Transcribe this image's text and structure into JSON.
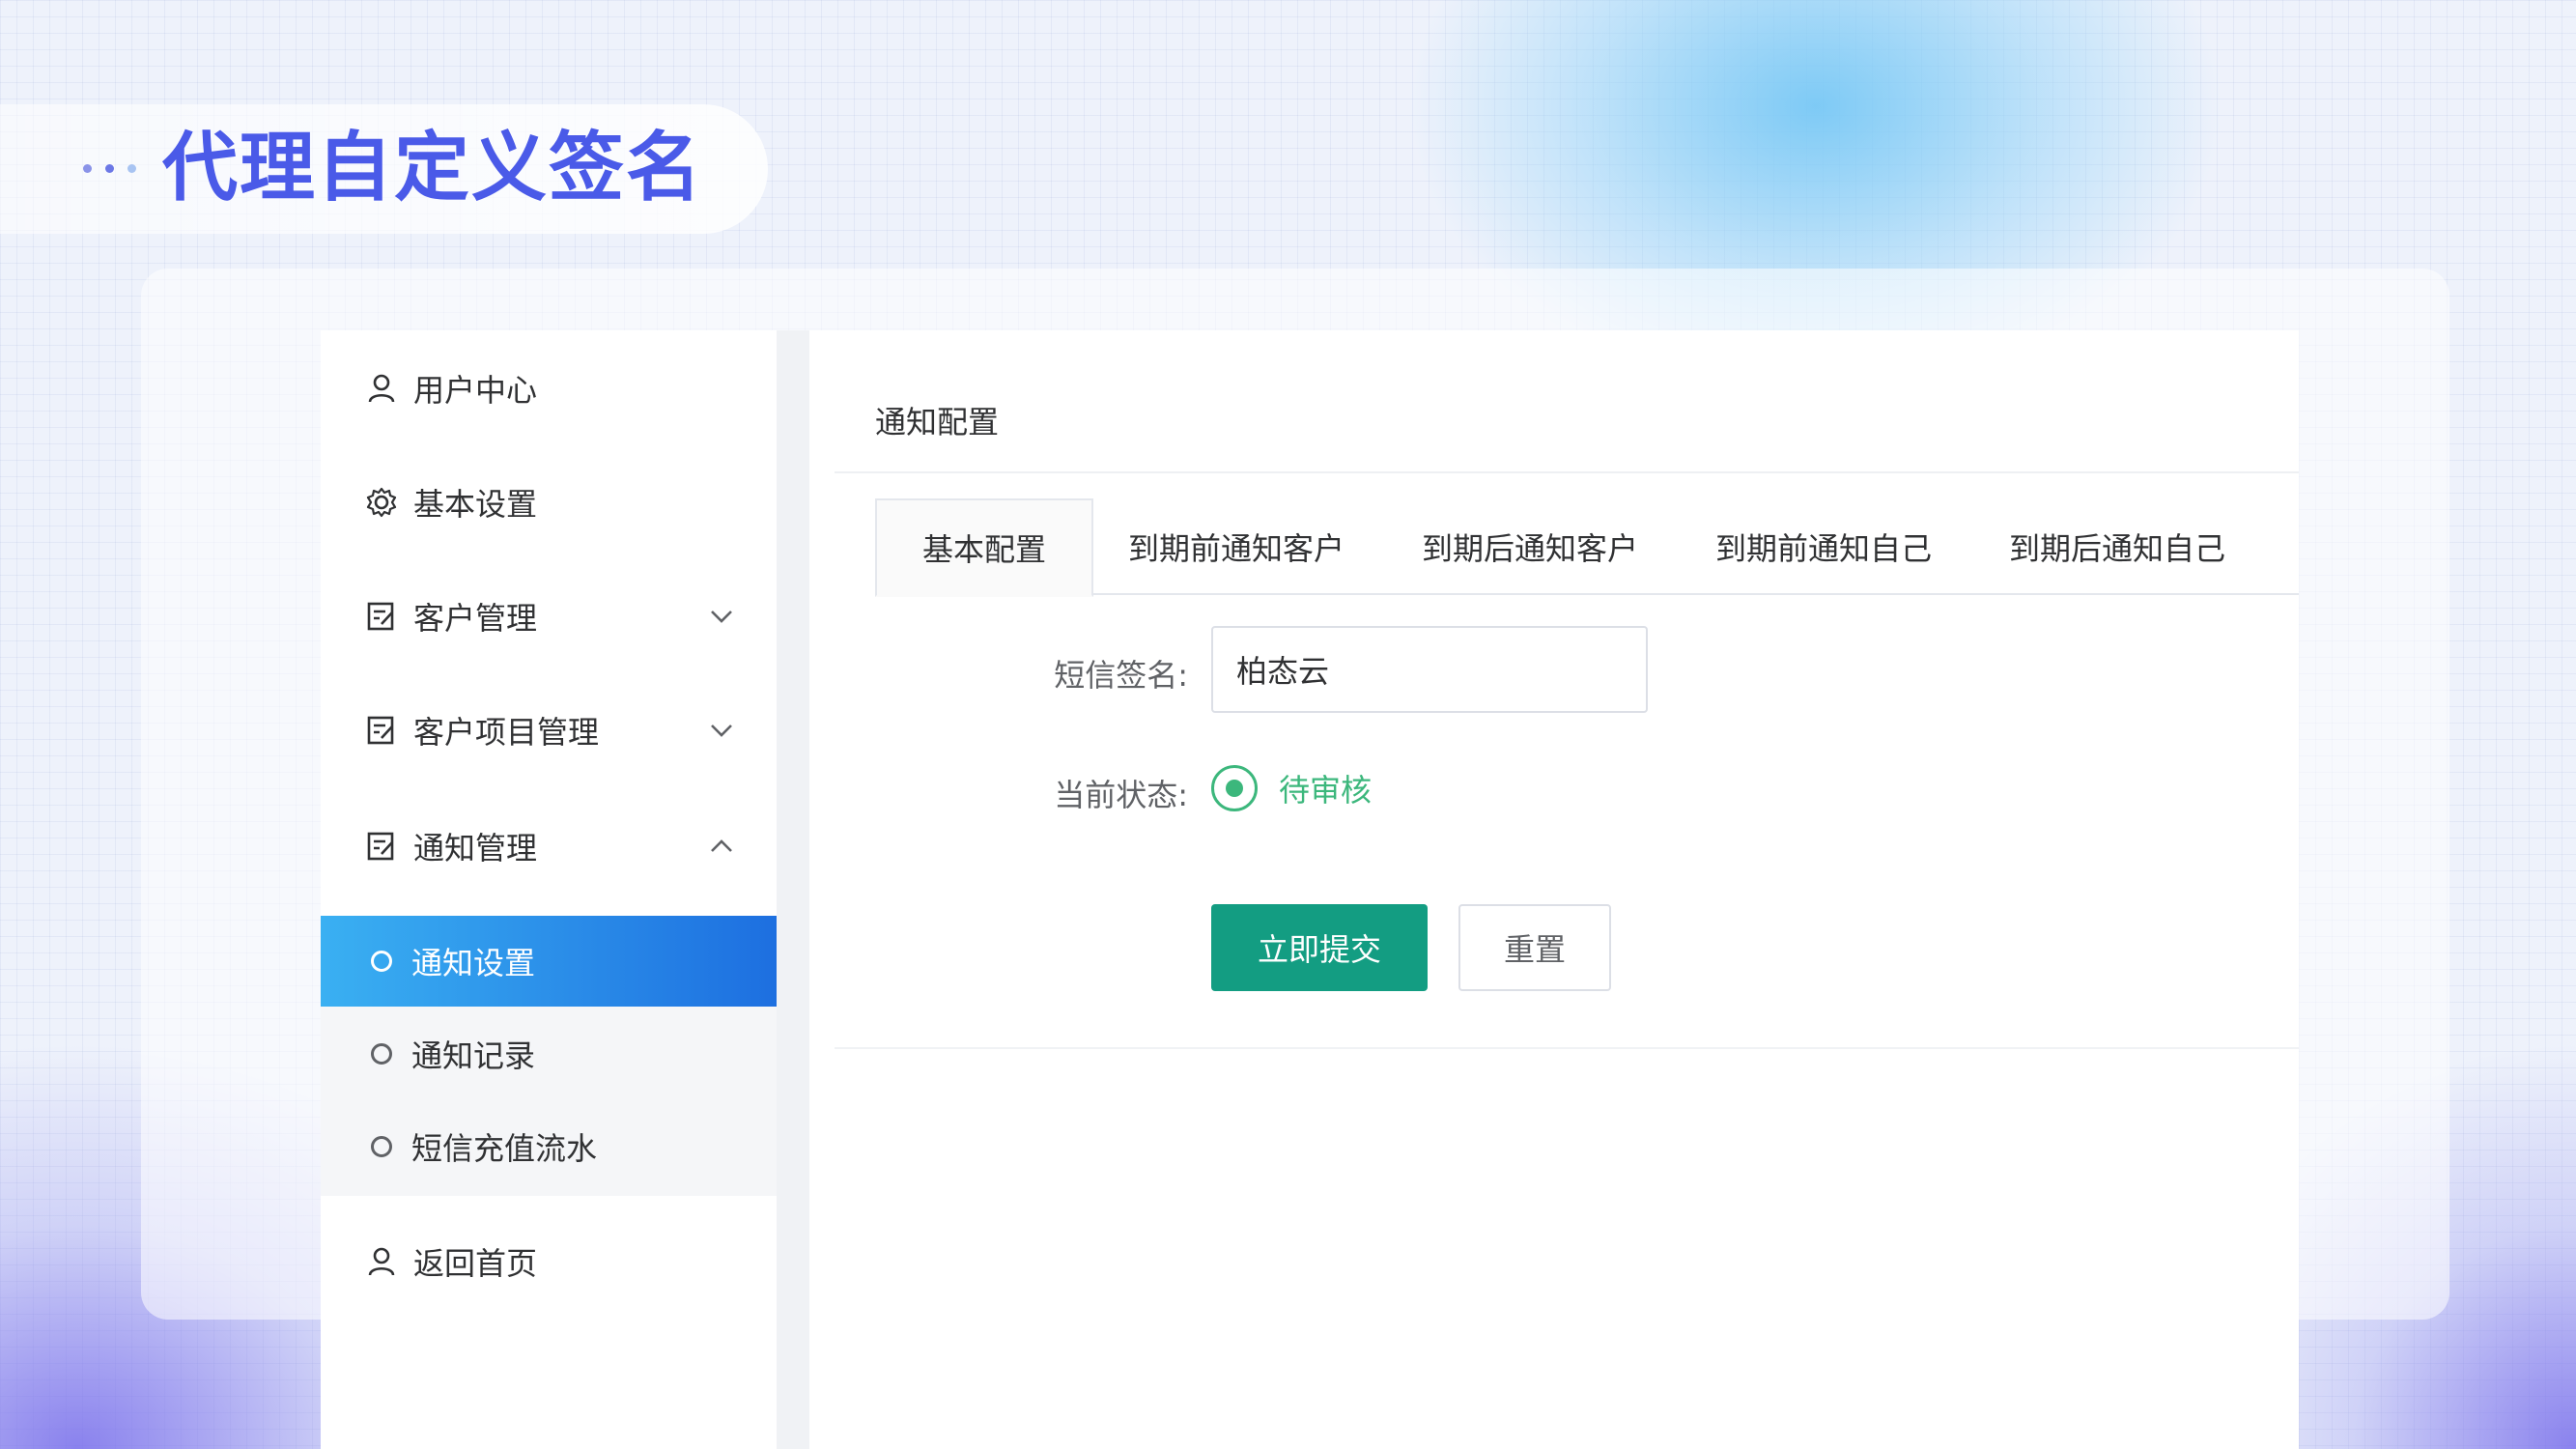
{
  "slide": {
    "title": "代理自定义签名"
  },
  "sidebar": {
    "items": [
      {
        "label": "用户中心",
        "icon": "user-icon"
      },
      {
        "label": "基本设置",
        "icon": "gear-icon"
      },
      {
        "label": "客户管理",
        "icon": "edit-icon",
        "chevron": "chevron-down-icon"
      },
      {
        "label": "客户项目管理",
        "icon": "edit-icon",
        "chevron": "chevron-down-icon"
      },
      {
        "label": "通知管理",
        "icon": "edit-icon",
        "chevron": "chevron-up-icon"
      }
    ],
    "submenu": [
      {
        "label": "通知设置",
        "active": true
      },
      {
        "label": "通知记录"
      },
      {
        "label": "短信充值流水"
      }
    ],
    "home": {
      "label": "返回首页",
      "icon": "user-icon"
    }
  },
  "main": {
    "panel_title": "通知配置",
    "tabs": [
      {
        "label": "基本配置",
        "active": true
      },
      {
        "label": "到期前通知客户"
      },
      {
        "label": "到期后通知客户"
      },
      {
        "label": "到期前通知自己"
      },
      {
        "label": "到期后通知自己"
      }
    ],
    "form": {
      "signature_label": "短信签名:",
      "signature_value": "柏态云",
      "status_label": "当前状态:",
      "status_value": "待审核",
      "submit_label": "立即提交",
      "reset_label": "重置"
    }
  },
  "colors": {
    "title": "#4a5ae8",
    "active_menu_start": "#3ab0f2",
    "active_menu_end": "#1d6fe0",
    "submit_button": "#139d82",
    "status_green": "#3cb77c"
  }
}
